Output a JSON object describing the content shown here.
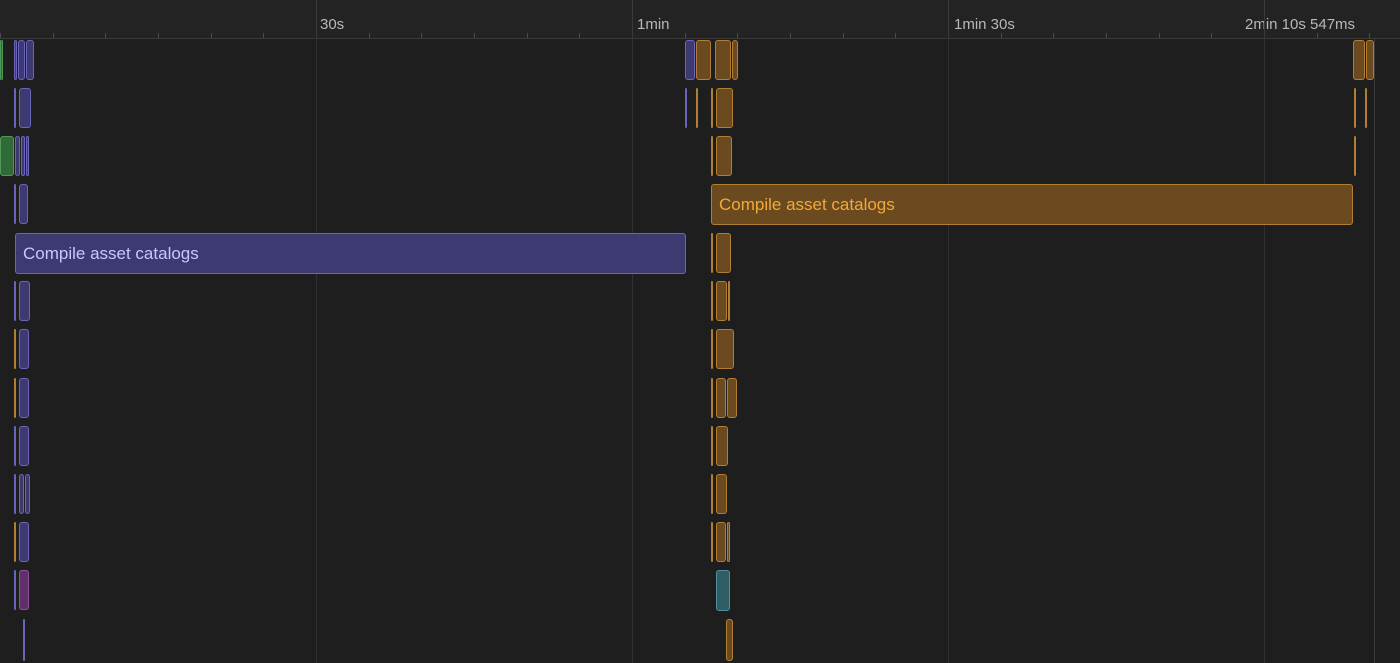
{
  "ruler": {
    "labels": [
      "30s",
      "1min",
      "1min 30s",
      "2min 10s 547ms"
    ]
  },
  "tasks": {
    "compile_asset_catalogs_1": "Compile asset catalogs",
    "compile_asset_catalogs_2": "Compile asset catalogs"
  },
  "colors": {
    "background": "#1e1e1f",
    "purple": "#3d3a72",
    "orange": "#6a4a1e",
    "green": "#2f6a38",
    "teal": "#2f5e66",
    "magenta": "#5e3068"
  }
}
